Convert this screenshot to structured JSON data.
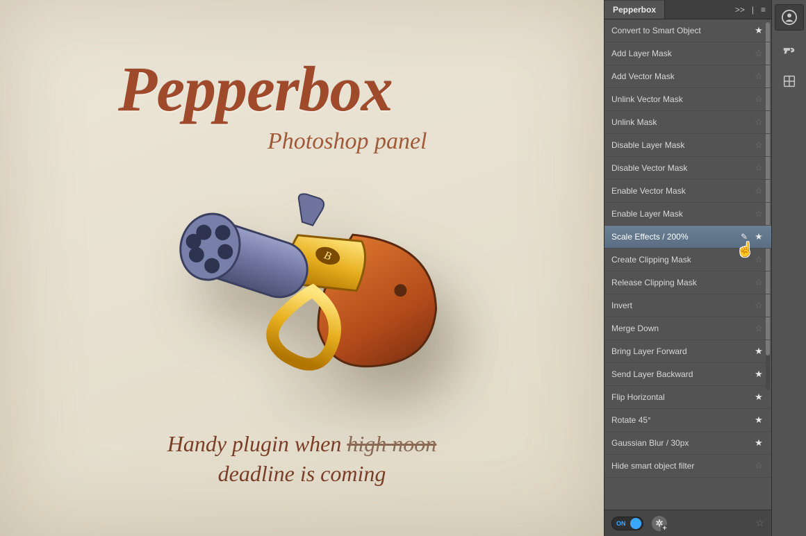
{
  "promo": {
    "title": "Pepperbox",
    "subtitle": "Photoshop panel",
    "tagline_prefix": "Handy plugin when ",
    "tagline_strike": "high noon",
    "tagline_line2": "deadline is coming"
  },
  "panel": {
    "tab_label": "Pepperbox",
    "collapse_icon": ">>",
    "menu_icon": "≡",
    "items": [
      {
        "label": "Convert to Smart Object",
        "favorite": true,
        "hover": false
      },
      {
        "label": "Add Layer Mask",
        "favorite": false,
        "hover": false
      },
      {
        "label": "Add Vector Mask",
        "favorite": false,
        "hover": false
      },
      {
        "label": "Unlink Vector Mask",
        "favorite": false,
        "hover": false
      },
      {
        "label": "Unlink Mask",
        "favorite": false,
        "hover": false
      },
      {
        "label": "Disable Layer Mask",
        "favorite": false,
        "hover": false
      },
      {
        "label": "Disable Vector Mask",
        "favorite": false,
        "hover": false
      },
      {
        "label": "Enable Vector Mask",
        "favorite": false,
        "hover": false
      },
      {
        "label": "Enable Layer Mask",
        "favorite": false,
        "hover": false
      },
      {
        "label": "Scale Effects / 200%",
        "favorite": true,
        "hover": true
      },
      {
        "label": "Create Clipping Mask",
        "favorite": false,
        "hover": false
      },
      {
        "label": "Release Clipping Mask",
        "favorite": false,
        "hover": false
      },
      {
        "label": "Invert",
        "favorite": false,
        "hover": false
      },
      {
        "label": "Merge Down",
        "favorite": false,
        "hover": false
      },
      {
        "label": "Bring Layer Forward",
        "favorite": true,
        "hover": false
      },
      {
        "label": "Send Layer Backward",
        "favorite": true,
        "hover": false
      },
      {
        "label": "Flip Horizontal",
        "favorite": true,
        "hover": false
      },
      {
        "label": "Rotate 45°",
        "favorite": true,
        "hover": false
      },
      {
        "label": "Gaussian Blur / 30px",
        "favorite": true,
        "hover": false
      },
      {
        "label": "Hide smart object filter",
        "favorite": false,
        "hover": false
      }
    ],
    "footer": {
      "toggle_label": "ON",
      "toggle_on": true
    }
  },
  "toolstrip": {
    "icons": [
      "person-circle-icon",
      "gun-icon",
      "grid-icon"
    ]
  }
}
